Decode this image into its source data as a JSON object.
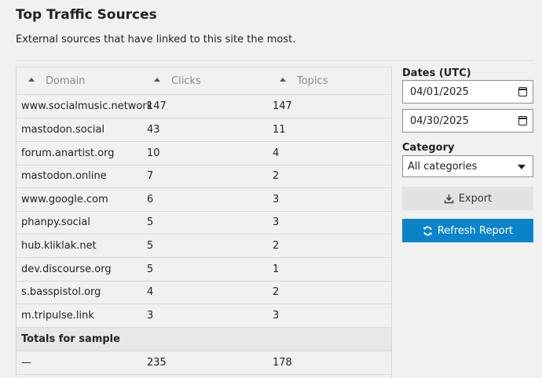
{
  "page": {
    "title": "Top Traffic Sources",
    "description": "External sources that have linked to this site the most."
  },
  "table": {
    "columns": [
      "Domain",
      "Clicks",
      "Topics"
    ],
    "rows": [
      [
        "www.socialmusic.network",
        "147",
        "147"
      ],
      [
        "mastodon.social",
        "43",
        "11"
      ],
      [
        "forum.anartist.org",
        "10",
        "4"
      ],
      [
        "mastodon.online",
        "7",
        "2"
      ],
      [
        "www.google.com",
        "6",
        "3"
      ],
      [
        "phanpy.social",
        "5",
        "3"
      ],
      [
        "hub.kliklak.net",
        "5",
        "2"
      ],
      [
        "dev.discourse.org",
        "5",
        "1"
      ],
      [
        "s.basspistol.org",
        "4",
        "2"
      ],
      [
        "m.tripulse.link",
        "3",
        "3"
      ]
    ],
    "totals_label": "Totals for sample",
    "totals": [
      "—",
      "235",
      "178"
    ]
  },
  "filters": {
    "dates_label": "Dates (UTC)",
    "start_date": "04/01/2025",
    "end_date": "04/30/2025",
    "category_label": "Category",
    "category_value": "All categories"
  },
  "actions": {
    "export_label": "Export",
    "refresh_label": "Refresh Report"
  },
  "colors": {
    "background": "#f1f1f1",
    "primary_button": "#0b83c9",
    "secondary_button": "#e2e2e2"
  }
}
